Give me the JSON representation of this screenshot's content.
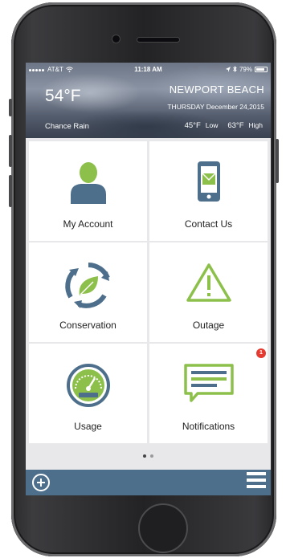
{
  "status_bar": {
    "carrier": "AT&T",
    "time": "11:18 AM",
    "battery": "79%"
  },
  "weather": {
    "temperature": "54°F",
    "city": "NEWPORT BEACH",
    "date": "THURSDAY December 24,2015",
    "condition": "Chance Rain",
    "low_value": "45°F",
    "low_label": "Low",
    "high_value": "63°F",
    "high_label": "High"
  },
  "tiles": [
    {
      "label": "My Account",
      "icon": "person-icon"
    },
    {
      "label": "Contact Us",
      "icon": "phone-message-icon"
    },
    {
      "label": "Conservation",
      "icon": "leaf-recycle-icon"
    },
    {
      "label": "Outage",
      "icon": "warning-icon"
    },
    {
      "label": "Usage",
      "icon": "gauge-icon"
    },
    {
      "label": "Notifications",
      "icon": "chat-notification-icon",
      "badge": "1"
    }
  ],
  "pager": {
    "pages": 2,
    "current": 1
  },
  "colors": {
    "accent_blue": "#4e6f8c",
    "accent_green": "#8cc04b",
    "badge_red": "#e53a2f"
  }
}
